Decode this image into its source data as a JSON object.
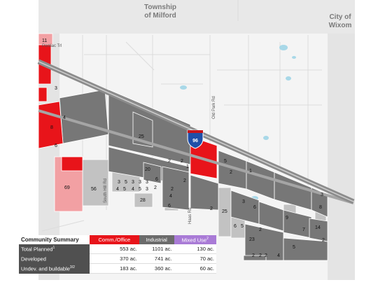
{
  "labels": {
    "township_line1": "Township",
    "township_line2": "of Milford",
    "city_line1": "City of",
    "city_line2": "Wixom",
    "road_pontiac": "Pontiac Trl",
    "road_oak_park": "Old Park Rd",
    "road_south_hill": "South Hill Rd",
    "road_haas": "Haas Rd",
    "interstate": "96"
  },
  "parcels": [
    "11",
    "3",
    "4",
    "8",
    "6",
    "69",
    "56",
    "25",
    "20",
    "2",
    "3",
    "5",
    "4",
    "5",
    "3",
    "3",
    "3",
    "6",
    "4",
    "5",
    "3",
    "2",
    "28",
    "4",
    "2",
    "2",
    "6",
    "2",
    "5",
    "2",
    "1",
    "25",
    "3",
    "6",
    "5",
    "6",
    "2",
    "23",
    "9",
    "8",
    "14",
    "5",
    "2",
    "3",
    "2",
    "2",
    "4",
    "7",
    "2",
    "2",
    "1"
  ],
  "summary": {
    "title": "Community Summary",
    "headers": [
      "Comm./Office",
      "Industrial",
      "Mixed Use"
    ],
    "header_superscript": "2",
    "rows": [
      {
        "label": "Total Planned",
        "sup": "1",
        "values": [
          "553 ac.",
          "1101 ac.",
          "130 ac."
        ]
      },
      {
        "label": "Developed",
        "sup": "",
        "values": [
          "370 ac.",
          "741 ac.",
          "70 ac."
        ]
      },
      {
        "label": "Undev. and buildable",
        "sup": "3/2",
        "values": [
          "183 ac.",
          "360 ac.",
          "60 ac."
        ]
      }
    ]
  },
  "colors": {
    "commercial_office": "#e8141a",
    "commercial_light": "#f2a0a3",
    "industrial": "#777777",
    "industrial_light": "#c2c2c2",
    "mixed_use": "#a97bd6",
    "highway": "#8c8c8c",
    "water": "#a8d8e8"
  }
}
